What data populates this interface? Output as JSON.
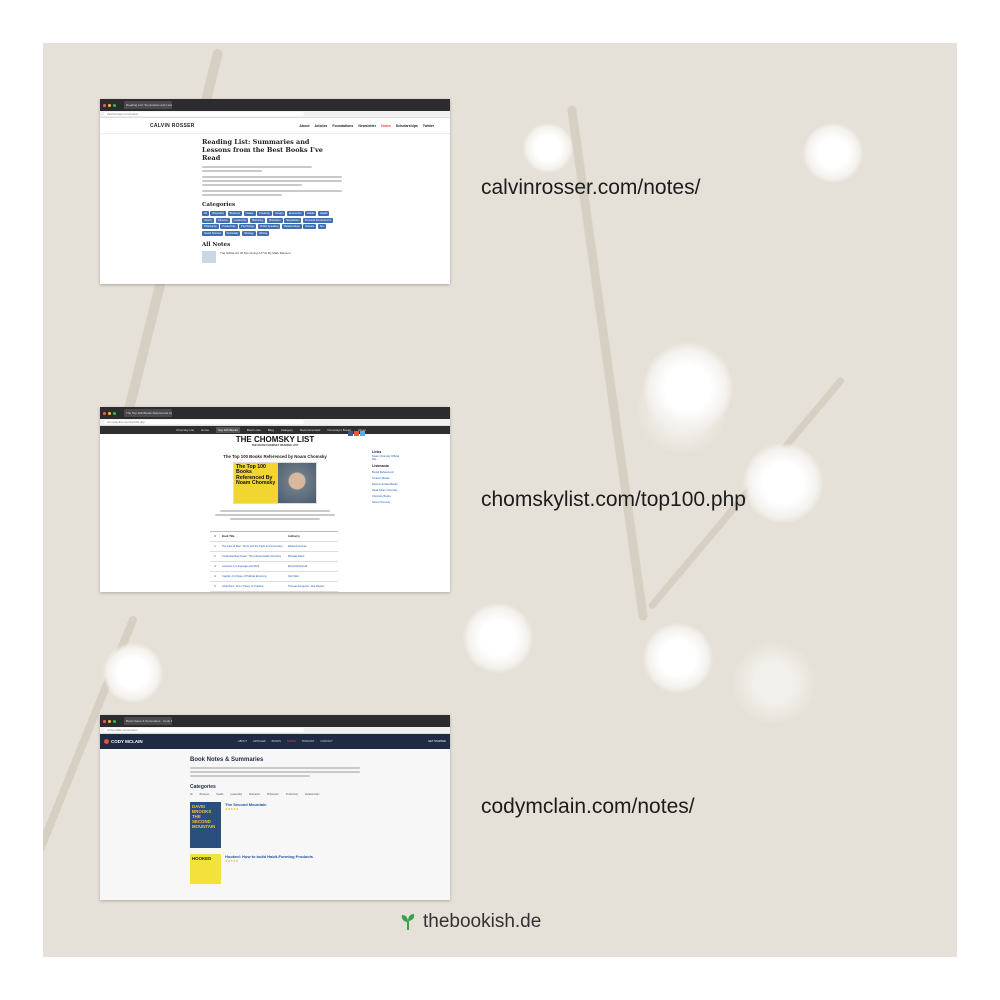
{
  "screens": [
    {
      "url_label": "calvinrosser.com/notes/",
      "browser_tab": "Reading List: Summaries and Lesso...",
      "address": "calvinrosser.com/notes/",
      "site_logo": "CALVIN ROSSER",
      "nav": [
        "About",
        "Articles",
        "Foundations",
        "Newsletter",
        "Notes",
        "Scholarships",
        "Twitter"
      ],
      "title": "Reading List: Summaries and Lessons from the Best Books I've Read",
      "categories_heading": "Categories",
      "categories": [
        "All",
        "Biography",
        "Business",
        "Career",
        "Creativity",
        "Design",
        "Economics",
        "Habits",
        "Health",
        "History",
        "Influence",
        "Leadership",
        "Marketing",
        "Motivation",
        "Negotiation",
        "Personal Development",
        "Philosophy",
        "Productivity",
        "Psychology",
        "Public Speaking",
        "Relationships",
        "Science",
        "Sex",
        "Social Science",
        "Spirituality",
        "Strategy",
        "Writing"
      ],
      "all_notes_heading": "All Notes",
      "first_note": "The Subtle Art Of Not Giving A F*ck By Mark Manson"
    },
    {
      "url_label": "chomskylist.com/top100.php",
      "browser_tab": "The Top 100 Books Referenced by Noam Chomsky",
      "address": "chomskylist.com/top100.php",
      "nav": [
        "Chomsky List",
        "Home",
        "Top 100 Books",
        "Book Lists",
        "Blog",
        "Category",
        "Recommended",
        "Chomsky's Books",
        "About"
      ],
      "logo": "THE CHOMSKY LIST",
      "logo_sub": "THE NOAM CHOMSKY READING LIST",
      "heading": "The Top 100 Books Referenced by Noam Chomsky",
      "book_cover_text": "The Top 100 Books Referenced By Noam Chomsky",
      "table_headers": [
        "#",
        "Book Title",
        "Author(s)"
      ],
      "rows": [
        [
          "1",
          "The Fate of Man: Terror and the Fight for Democracy",
          "Edward Herman"
        ],
        [
          "2",
          "Understanding Power: The Indispensable Chomsky",
          "Michael Albert"
        ],
        [
          "3",
          "Lectures on Language and Mind",
          "Bertrand Russell"
        ],
        [
          "4",
          "Capital: A Critique of Political Economy",
          "Karl Marx"
        ],
        [
          "5",
          "Anarchism: From Theory to Practice",
          "Thomas Ferguson, Joel Rogers"
        ]
      ],
      "sidebar": {
        "links_heading": "Links",
        "links": [
          "Noam Chomsky Official Site"
        ],
        "listmania_heading": "Listmania",
        "list_links": [
          "Books Referenced",
          "Amazon Books",
          "Recommended Books",
          "Read Noam Chomsky",
          "Chomsky Books",
          "About Chomsky"
        ]
      }
    },
    {
      "url_label": "codymclain.com/notes/",
      "browser_tab": "Book Notes & Summaries - Cody McLain",
      "address": "codymclain.com/notes/",
      "logo": "CODY MCLAIN",
      "nav": [
        "ABOUT",
        "ARTICLES",
        "BOOKS",
        "NOTES",
        "PODCAST",
        "CONTACT"
      ],
      "right_action": "GET STARTED",
      "heading": "Book Notes & Summaries",
      "categories_heading": "Categories",
      "categories": [
        "All",
        "Business",
        "Health",
        "Leadership",
        "Motivation",
        "Philosophy",
        "Productivity",
        "Relationships"
      ],
      "books": [
        {
          "title": "The Second Mountain",
          "cover": "DAVID BROOKS THE SECOND MOUNTAIN",
          "stars": "★★★★★"
        },
        {
          "title": "Hooked: How to build Habit-Forming Products",
          "cover": "HOOKED",
          "stars": "★★★★★"
        }
      ]
    }
  ],
  "footer": {
    "brand": "thebookish.de",
    "brand_icon": "sprout-icon"
  },
  "colors": {
    "background": "#e6e1d8",
    "calvin_tag": "#3f6fb1",
    "cody_header": "#1f2a44",
    "cody_accent": "#e0543c",
    "chomsky_cover": "#f1d531",
    "sprout": "#3aa04a"
  }
}
